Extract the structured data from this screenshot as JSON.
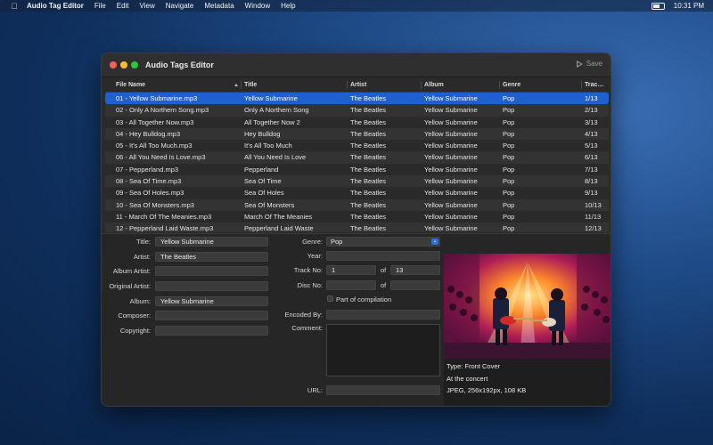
{
  "menubar": {
    "app": "Audio Tag Editor",
    "items": [
      "File",
      "Edit",
      "View",
      "Navigate",
      "Metadata",
      "Window",
      "Help"
    ],
    "time": "10:31 PM"
  },
  "window": {
    "title": "Audio Tags Editor",
    "save_label": "Save"
  },
  "table": {
    "columns": [
      "File Name",
      "Title",
      "Artist",
      "Album",
      "Genre",
      "Trac…"
    ],
    "rows": [
      [
        "01 - Yellow Submarine.mp3",
        "Yellow Submarine",
        "The Beatles",
        "Yellow Submarine",
        "Pop",
        "1/13"
      ],
      [
        "02 - Only A Northern Song.mp3",
        "Only A Northern Song",
        "The Beatles",
        "Yellow Submarine",
        "Pop",
        "2/13"
      ],
      [
        "03 - All Together Now.mp3",
        "All Together Now 2",
        "The Beatles",
        "Yellow Submarine",
        "Pop",
        "3/13"
      ],
      [
        "04 - Hey Bulldog.mp3",
        "Hey Bulldog",
        "The Beatles",
        "Yellow Submarine",
        "Pop",
        "4/13"
      ],
      [
        "05 - It's All Too Much.mp3",
        "It's All Too Much",
        "The Beatles",
        "Yellow Submarine",
        "Pop",
        "5/13"
      ],
      [
        "06 - All You Need Is Love.mp3",
        "All You Need Is Love",
        "The Beatles",
        "Yellow Submarine",
        "Pop",
        "6/13"
      ],
      [
        "07 - Pepperland.mp3",
        "Pepperland",
        "The Beatles",
        "Yellow Submarine",
        "Pop",
        "7/13"
      ],
      [
        "08 - Sea Of Time.mp3",
        "Sea Of Time",
        "The Beatles",
        "Yellow Submarine",
        "Pop",
        "8/13"
      ],
      [
        "09 - Sea Of Holes.mp3",
        "Sea Of Holes",
        "The Beatles",
        "Yellow Submarine",
        "Pop",
        "9/13"
      ],
      [
        "10 - Sea Of Monsters.mp3",
        "Sea Of Monsters",
        "The Beatles",
        "Yellow Submarine",
        "Pop",
        "10/13"
      ],
      [
        "11 - March Of The Meanies.mp3",
        "March Of The Meanies",
        "The Beatles",
        "Yellow Submarine",
        "Pop",
        "11/13"
      ],
      [
        "12 - Pepperland Laid Waste.mp3",
        "Pepperland Laid Waste",
        "The Beatles",
        "Yellow Submarine",
        "Pop",
        "12/13"
      ]
    ]
  },
  "form": {
    "title_label": "Title:",
    "title": "Yellow Submarine",
    "artist_label": "Artist:",
    "artist": "The Beatles",
    "album_artist_label": "Album Artist:",
    "album_artist": "",
    "original_artist_label": "Original Artist:",
    "original_artist": "",
    "album_label": "Album:",
    "album": "Yellow Submarine",
    "composer_label": "Composer:",
    "composer": "",
    "copyright_label": "Copyright:",
    "copyright": "",
    "genre_label": "Genre:",
    "genre": "Pop",
    "year_label": "Year:",
    "year": "",
    "track_label": "Track No:",
    "track_no": "1",
    "track_of_label": "of",
    "track_total": "13",
    "disc_label": "Disc No:",
    "disc_no": "",
    "disc_of_label": "of",
    "disc_total": "",
    "compilation_label": "Part of compilation",
    "encoded_by_label": "Encoded By:",
    "encoded_by": "",
    "comment_label": "Comment:",
    "url_label": "URL:",
    "url": ""
  },
  "artwork": {
    "type": "Type: Front Cover",
    "description": "At the concert",
    "info": "JPEG, 256x192px, 108 KB"
  },
  "colors": {
    "selection": "#1f5fd0",
    "accent": "#2f6fe0"
  }
}
